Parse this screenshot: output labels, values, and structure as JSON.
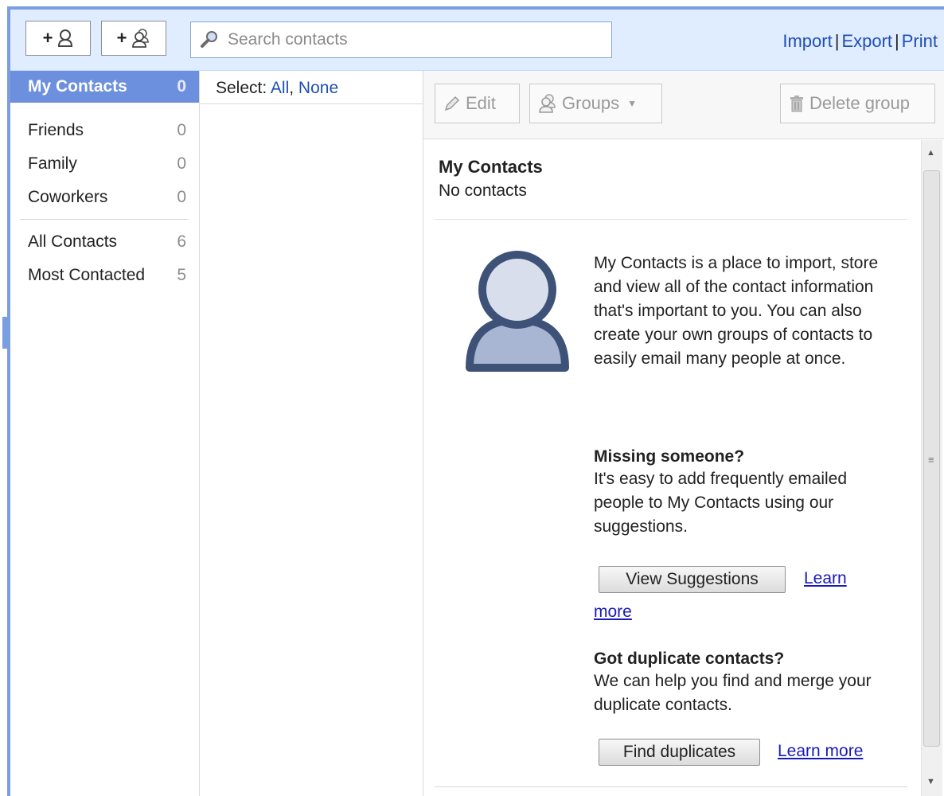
{
  "toolbar": {
    "add_contact_plus": "+",
    "add_group_plus": "+",
    "search_placeholder": "Search contacts",
    "import_label": "Import",
    "export_label": "Export",
    "print_label": "Print",
    "separator": "|"
  },
  "sidebar": {
    "items": [
      {
        "label": "My Contacts",
        "count": "0"
      },
      {
        "label": "Friends",
        "count": "0"
      },
      {
        "label": "Family",
        "count": "0"
      },
      {
        "label": "Coworkers",
        "count": "0"
      },
      {
        "label": "All Contacts",
        "count": "6"
      },
      {
        "label": "Most Contacted",
        "count": "5"
      }
    ]
  },
  "list": {
    "select_label": "Select:",
    "all_label": "All",
    "comma": ",",
    "none_label": "None"
  },
  "actions": {
    "edit_label": "Edit",
    "groups_label": "Groups",
    "delete_group_label": "Delete group"
  },
  "detail": {
    "title": "My Contacts",
    "subtitle": "No contacts",
    "intro": "My Contacts is a place to import, store and view all of the contact information that's important to you. You can also create your own groups of contacts to easily email many people at once.",
    "missing_title": "Missing someone?",
    "missing_text": "It's easy to add frequently emailed people to My Contacts using our suggestions.",
    "view_suggestions_label": "View Suggestions",
    "learn_more_1_a": "Learn",
    "learn_more_1_b": "more",
    "duplicates_title": "Got duplicate contacts?",
    "duplicates_text": "We can help you find and merge your duplicate contacts.",
    "find_duplicates_label": "Find duplicates",
    "learn_more_2": "Learn more"
  },
  "colors": {
    "accent": "#7a9fe0",
    "selected_row": "#6c8fde",
    "toolbar_bg": "#e0ecff",
    "link": "#1f4fb5",
    "avatar_dark": "#3e5278",
    "avatar_light": "#d9deec"
  },
  "icons": {
    "add_contact": "add-contact-icon",
    "add_group": "add-group-icon",
    "search": "search-icon",
    "edit": "pencil-icon",
    "groups": "groups-icon",
    "delete": "trash-icon",
    "avatar": "person-avatar-icon"
  }
}
